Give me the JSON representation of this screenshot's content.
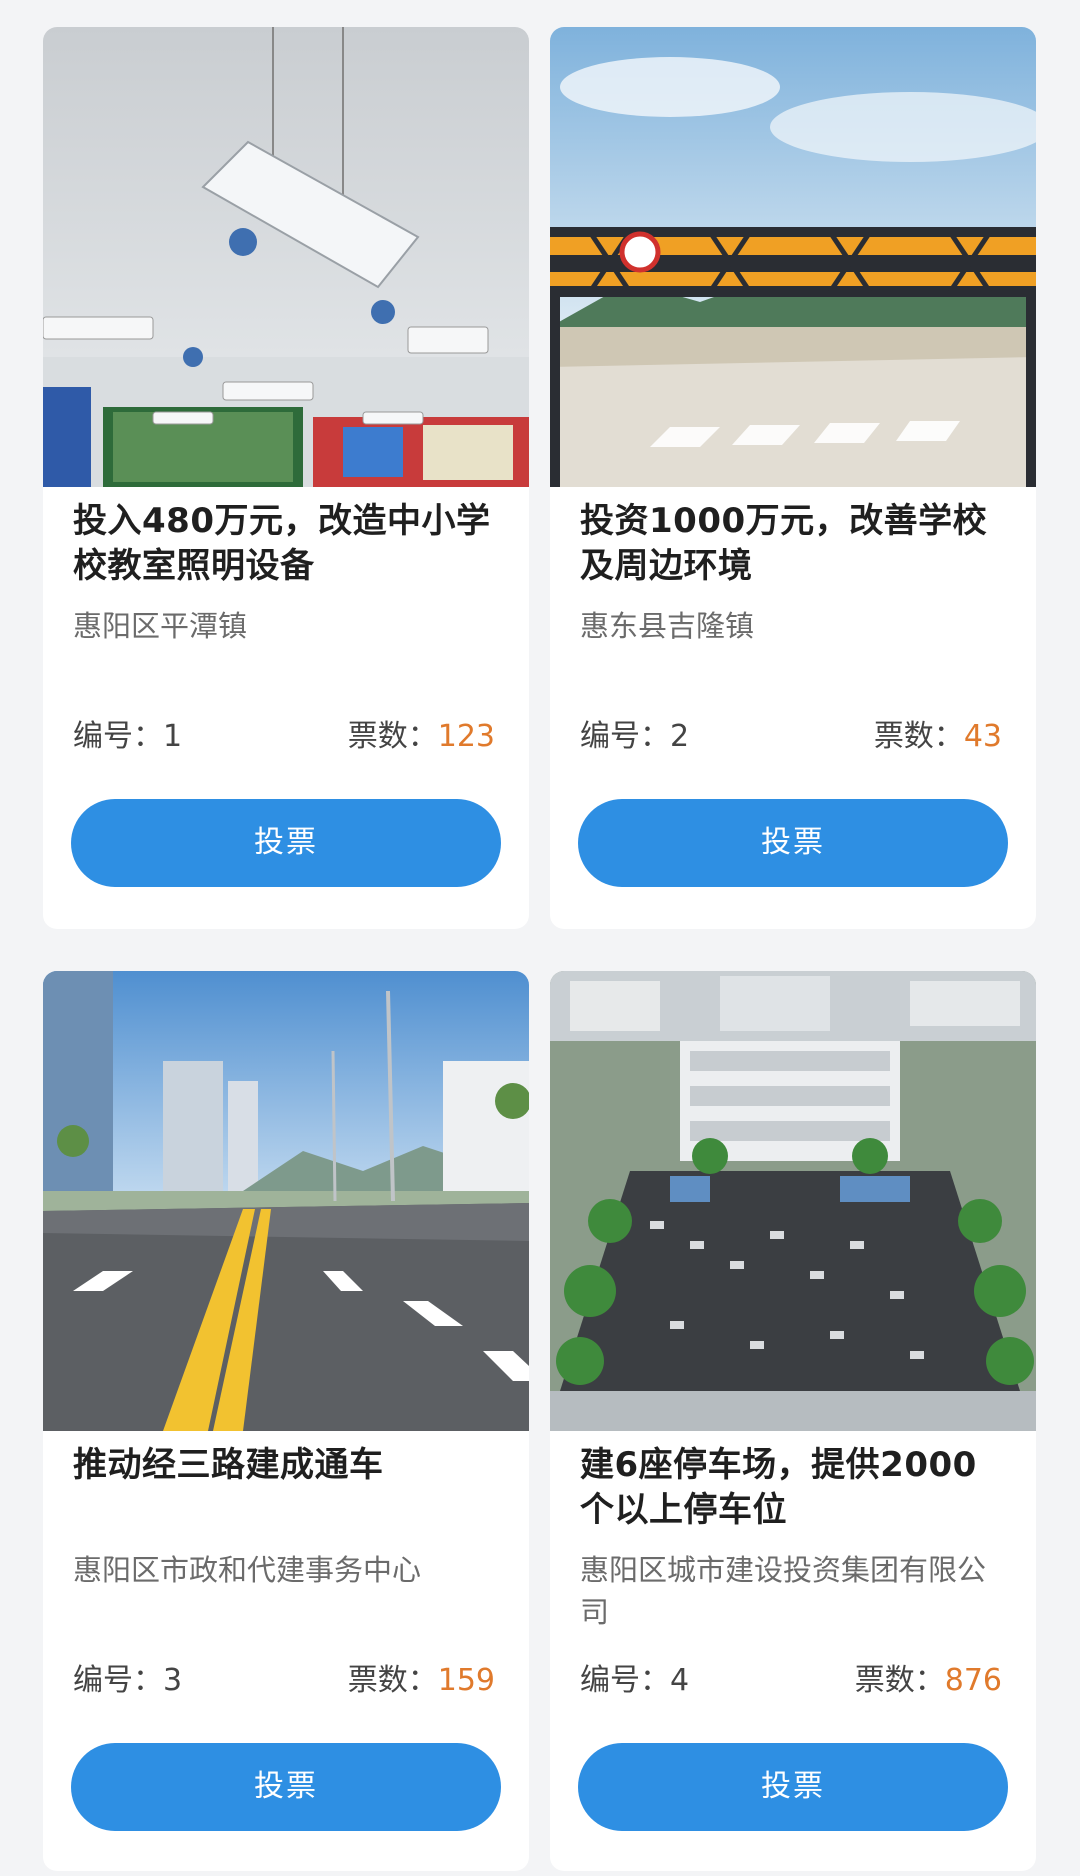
{
  "projects": [
    {
      "title": "投入480万元，改造中小学校教室照明设备",
      "org": "惠阳区平潭镇",
      "number_label": "编号：",
      "number": "1",
      "votes_label": "票数：",
      "votes": "123",
      "button_label": "投票",
      "image": "classroom-lighting-photo"
    },
    {
      "title": "投资1000万元，改善学校及周边环境",
      "org": "惠东县吉隆镇",
      "number_label": "编号：",
      "number": "2",
      "votes_label": "票数：",
      "votes": "43",
      "button_label": "投票",
      "image": "height-limit-gate-photo"
    },
    {
      "title": "推动经三路建成通车",
      "org": "惠阳区市政和代建事务中心",
      "number_label": "编号：",
      "number": "3",
      "votes_label": "票数：",
      "votes": "159",
      "button_label": "投票",
      "image": "new-road-photo"
    },
    {
      "title": "建6座停车场，提供2000个以上停车位",
      "org": "惠阳区城市建设投资集团有限公司",
      "number_label": "编号：",
      "number": "4",
      "votes_label": "票数：",
      "votes": "876",
      "button_label": "投票",
      "image": "parking-lot-aerial-photo"
    }
  ],
  "colors": {
    "accent": "#2e8fe3",
    "vote_count": "#e07a2c",
    "background": "#f3f4f6"
  }
}
